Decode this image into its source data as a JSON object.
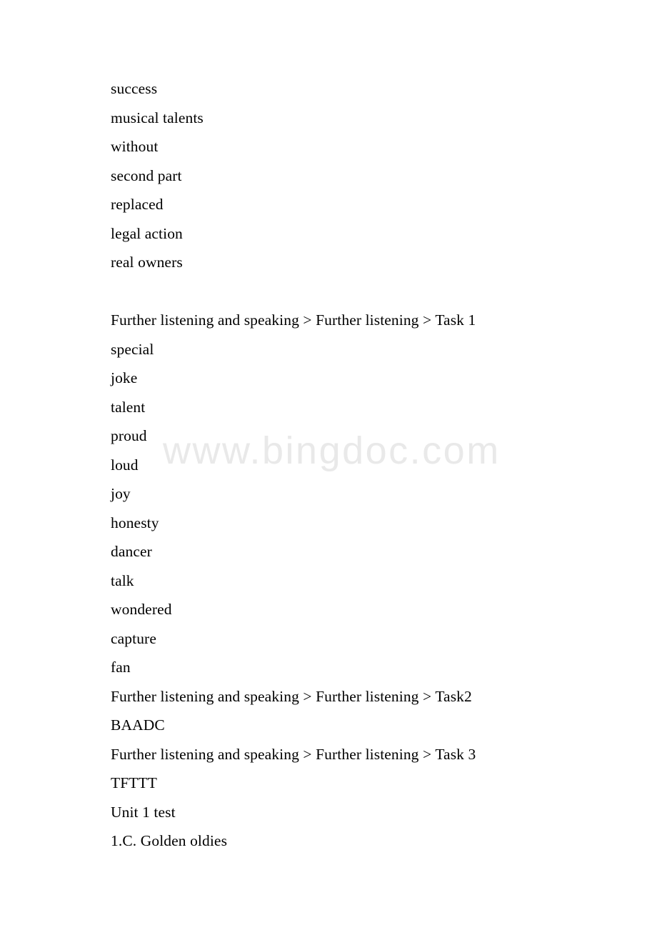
{
  "document": {
    "watermark": "www.bingdoc.com",
    "sections": [
      {
        "name": "answer-list-top",
        "lines": [
          "success",
          "musical talents",
          "without",
          "second part",
          "replaced",
          "legal action",
          "real owners"
        ]
      },
      {
        "name": "spacer",
        "lines": [
          ""
        ]
      },
      {
        "name": "further-listening-task-1",
        "heading": "Further listening and speaking > Further listening > Task 1",
        "lines": [
          "special",
          "joke",
          "talent",
          "proud",
          "loud",
          "joy",
          "honesty",
          "dancer",
          "talk",
          "wondered",
          "capture",
          "fan"
        ]
      },
      {
        "name": "further-listening-task-2",
        "heading": "Further listening and speaking > Further listening > Task2",
        "lines": [
          "BAADC"
        ]
      },
      {
        "name": "further-listening-task-3",
        "heading": "Further listening and speaking > Further listening > Task 3",
        "lines": [
          "TFTTT"
        ]
      },
      {
        "name": "unit-1-test",
        "heading": "Unit 1 test",
        "lines": [
          "1.C. Golden oldies"
        ]
      }
    ],
    "all_lines": [
      "success",
      "musical talents",
      "without",
      "second part",
      "replaced",
      "legal action",
      "real owners",
      "",
      "Further listening and speaking > Further listening > Task 1",
      "special",
      "joke",
      "talent",
      "proud",
      "loud",
      "joy",
      "honesty",
      "dancer",
      "talk",
      "wondered",
      "capture",
      "fan",
      "Further listening and speaking > Further listening > Task2",
      "BAADC",
      "Further listening and speaking > Further listening > Task 3",
      "TFTTT",
      "Unit 1 test",
      "1.C. Golden oldies"
    ]
  }
}
